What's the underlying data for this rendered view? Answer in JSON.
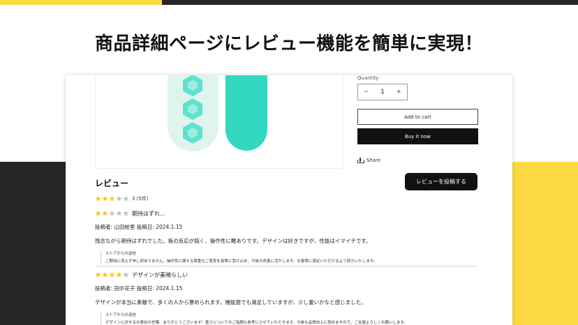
{
  "headline": "商品詳細ページにレビュー機能を簡単に実現！",
  "product": {
    "quantity_label": "Quantity",
    "quantity_value": "1",
    "decrement": "−",
    "increment": "+",
    "add_to_cart": "Add to cart",
    "buy_now": "Buy it now",
    "share": "Share"
  },
  "reviews": {
    "title": "レビュー",
    "post_button": "レビューを投稿する",
    "average_rating": 3,
    "average_text": "3 (5件)",
    "items": [
      {
        "rating": 2,
        "title": "期待はずれ...",
        "meta": "投稿者: 山田絵里 投稿日: 2024.1.15",
        "body": "残念ながら期待はずれでした。板の反応が鈍く、操作性に難ありです。デザインは好きですが、性能はイマイチです。",
        "reply_label": "ストアからの返信",
        "reply_text": "ご期待に添えず申し訳ありません。操作性に関する貴重なご意見を真摯に受け止め、今後の改善に活かします。お客様に満足いただけるよう努力いたします。"
      },
      {
        "rating": 4,
        "title": "デザインが素晴らしい",
        "meta": "投稿者: 田中花子 投稿日: 2024.1.15",
        "body": "デザインが本当に素敵で、多くの人から褒められます。機能面でも満足していますが、少し重いかなと感じました。",
        "reply_label": "ストアからの返信",
        "reply_text": "デザインに対するお褒めの言葉、ありがとうございます！重さについてのご指摘も参考にさせていただきます。今後も品質向上に努めますので、ご支援よろしくお願いします。"
      }
    ]
  },
  "colors": {
    "accent_yellow": "#fcd940",
    "dark_band": "#262626",
    "star_on": "#f3c31b",
    "star_off": "#bdbdbd",
    "board_mint": "#dff4ec",
    "board_teal": "#32d8c0"
  },
  "icons": {
    "share": "share-icon",
    "star": "star-icon"
  }
}
